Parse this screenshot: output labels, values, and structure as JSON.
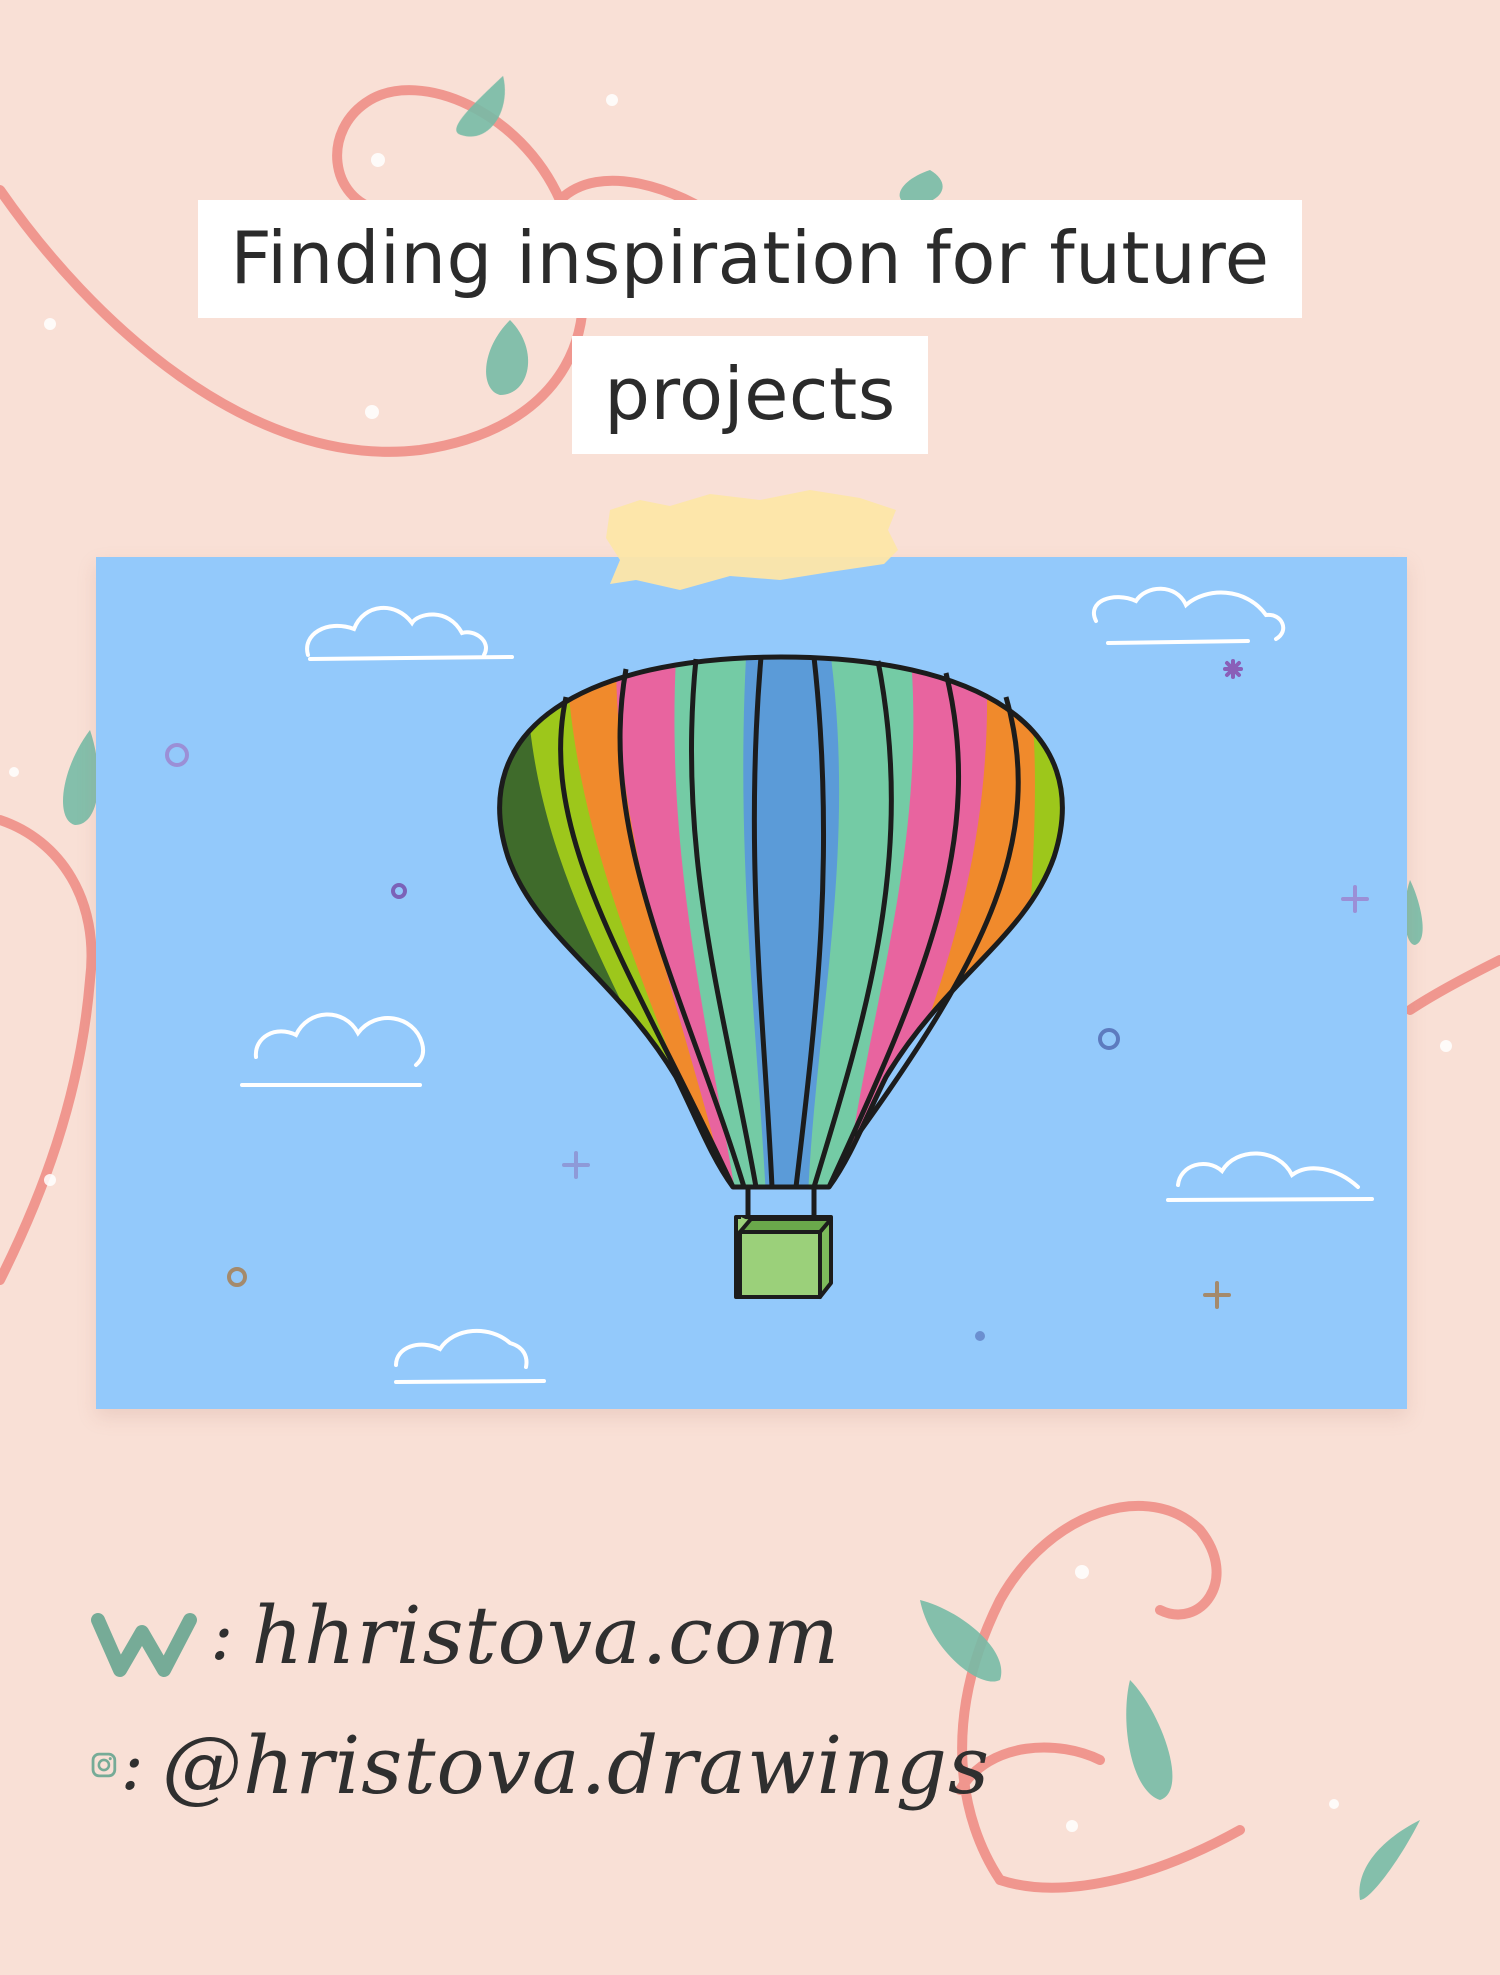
{
  "title": {
    "line1": "Finding inspiration for future",
    "line2": "projects"
  },
  "contact": {
    "website": "hhristova.com",
    "instagram": "@hristova.drawings",
    "website_icon": "w-letter-icon",
    "instagram_icon": "instagram-icon"
  },
  "colors": {
    "background": "#f9e0d6",
    "sky": "#93c9fb",
    "vine": "#ef8a82",
    "leaf": "#76bba6",
    "tape": "#fde6a8"
  }
}
